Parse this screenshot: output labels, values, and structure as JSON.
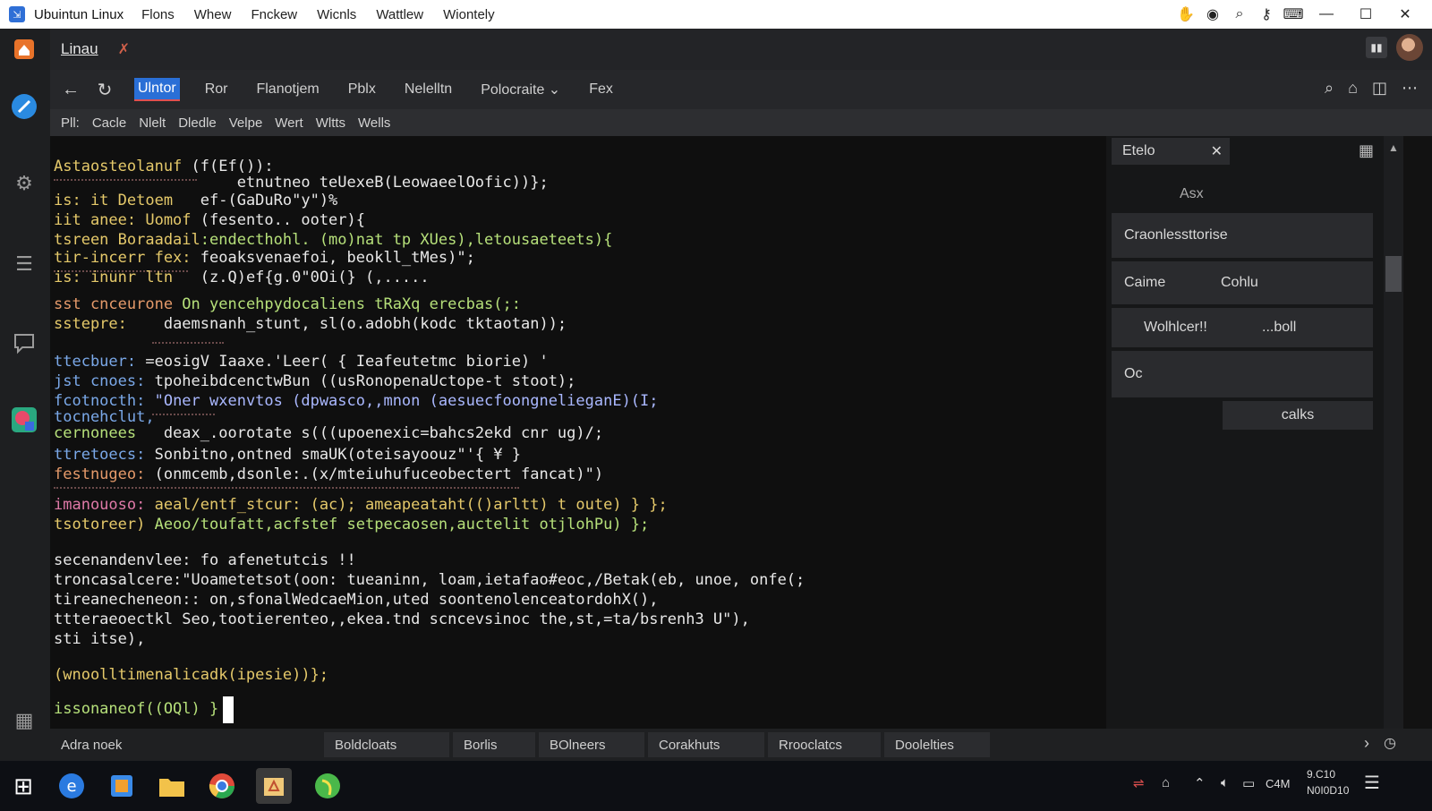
{
  "window": {
    "title": "Ubuintun Linux",
    "menu": [
      "Flons",
      "Whew",
      "Fnckew",
      "Wicnls",
      "Wattlew",
      "Wiontely"
    ],
    "controls": {
      "minimize": "—",
      "maximize": "☐",
      "close": "✕"
    }
  },
  "header": {
    "title": "Linau",
    "pin_glyph": "✗",
    "btn_glyph": "▮▮"
  },
  "nav": {
    "back": "←",
    "refresh": "↻",
    "tabs": [
      "Ulntor",
      "Ror",
      "Flanotjem",
      "Pblx",
      "Nelelltn",
      "Polocraite ⌄",
      "Fex"
    ],
    "active_tab": 0
  },
  "submenu": [
    "Pll:",
    "Cacle",
    "Nlelt",
    "Dledle",
    "Velpe",
    "Wert",
    "Wltts",
    "Wells"
  ],
  "code_lines": [
    {
      "label": "Astaosteolanuf",
      "code": " (f(Ef()):",
      "label_color": "#e5c96a",
      "code_color": "#e8e8e8"
    },
    {
      "label": "",
      "code": "                    etnutneo teUexeB(LeowaeelOofic))};",
      "label_color": "#e5c96a",
      "code_color": "#e8e8e8"
    },
    {
      "label": "is: it Detoem ",
      "code": "  ef-(GaDuRo\"y\")%",
      "label_color": "#e5c96a",
      "code_color": "#e8e8e8"
    },
    {
      "label": "iit anee: Uomof",
      "code": " (fesento.. ooter){",
      "label_color": "#e5c96a",
      "code_color": "#e8e8e8"
    },
    {
      "label": "tsreen Boraadail",
      "code": ":endecthohl. (mo)nat tp XUes),letousaeteets){",
      "label_color": "#e5c96a",
      "code_color": "#b6e07a"
    },
    {
      "label": "tir-incerr fex:",
      "code": " feoaksvenaefoi, beokll_tMes)\";",
      "label_color": "#e5c96a",
      "code_color": "#e8e8e8"
    },
    {
      "label": "is: inunr ltn ",
      "code": "  (z.Q)ef{g.0\"0Oi(} (,.....",
      "label_color": "#e5c96a",
      "code_color": "#e8e8e8"
    },
    {
      "label": "sst cnceurone ",
      "code": "On yencehpydocaliens tRaXq erecbas(;:",
      "label_color": "#e59a6a",
      "code_color": "#b6e07a"
    },
    {
      "label": "sstepre:    ",
      "code": "daemsnanh_stunt, sl(o.adobh(kodc tktaotan));",
      "label_color": "#e5c96a",
      "code_color": "#e8e8e8"
    },
    {
      "label": "ttecbuer:",
      "code": " =eosigV Iaaxe.'Leer( { Ieafeutetmc biorie) '",
      "label_color": "#7aa8e8",
      "code_color": "#e8e8e8"
    },
    {
      "label": "jst cnoes:",
      "code": " tpoheibdcenctwBun ((usRonopenaUctope-t stoot);",
      "label_color": "#7aa8e8",
      "code_color": "#e8e8e8"
    },
    {
      "label": "fcotnocth:",
      "code": " \"Oner wxenvtos (dpwasco,,mnon (aesuecfoongnelieganE)(I;",
      "label_color": "#7aa8e8",
      "code_color": "#aab8ff"
    },
    {
      "label": "tocnehclut,",
      "code": "",
      "label_color": "#7aa8e8",
      "code_color": "#e8e8e8"
    },
    {
      "label": "cernonees   ",
      "code": "deax_.oorotate s(((upoenexic=bahcs2ekd cnr ug)/;",
      "label_color": "#b6e07a",
      "code_color": "#e8e8e8"
    },
    {
      "label": "ttretoecs:",
      "code": " Sonbitno,ontned smaUK(oteisayoouz\"'{ ¥ }",
      "label_color": "#7aa8e8",
      "code_color": "#e8e8e8"
    },
    {
      "label": "festnugeo:",
      "code": " (onmcemb,dsonle:.(x/mteiuhufuceobectert fancat)\")",
      "label_color": "#e59a6a",
      "code_color": "#e8e8e8"
    },
    {
      "label": "imanouoso:",
      "code": " aeal/entf_stcur: (ac); ameapeataht(()arltt) t oute) } };",
      "label_color": "#e07aa8",
      "code_color": "#e5c96a"
    },
    {
      "label": "tsotoreer)",
      "code": " Aeoo/toufatt,acfstef setpecaosen,auctelit otjlohPu) };",
      "label_color": "#e5c96a",
      "code_color": "#b6e07a"
    },
    {
      "label": "secenandenvlee:",
      "code": " fo afenetutcis !!",
      "label_color": "#e8e8e8",
      "code_color": "#e8e8e8"
    },
    {
      "label": "troncasalcere:",
      "code": "\"Uoametetsot(oon: tueaninn, loam,ietafao#eoc,/Betak(eb, unoe, onfe(;",
      "label_color": "#e8e8e8",
      "code_color": "#e8e8e8"
    },
    {
      "label": "tireanecheneon::",
      "code": " on,sfonalWedcaeMion,uted soontenolenceatordohX(),",
      "label_color": "#e8e8e8",
      "code_color": "#e8e8e8"
    },
    {
      "label": "ttteraeoectkl",
      "code": " Seo,tootierenteo,,ekea.tnd scncevsinoc the,st,=ta/bsrenh3 U\"),",
      "label_color": "#e8e8e8",
      "code_color": "#e8e8e8"
    },
    {
      "label": "sti itse),",
      "code": "",
      "label_color": "#e8e8e8",
      "code_color": "#e8e8e8"
    },
    {
      "label": "(wnoolltimenalicadk(ipesie))};",
      "code": "",
      "label_color": "#e5c96a",
      "code_color": "#e8e8e8"
    },
    {
      "label": "issonaneof((OQl) }",
      "code": "",
      "label_color": "#b6e07a",
      "code_color": "#e8e8e8"
    }
  ],
  "right_panel": {
    "title": "Etelo",
    "close_glyph": "✕",
    "grid_glyph": "▦",
    "subtitle": "Asx",
    "item1": "Craonlessttorise",
    "item2_left": "Caime",
    "item2_right": "Cohlu",
    "item3_left": "Wolhlcer!!",
    "item3_right": "...boll",
    "item4": "Oc",
    "button": "calks"
  },
  "bottom_tabs": [
    "Adra noek",
    "Boldcloats",
    "Borlis",
    "BOlneers",
    "Corakhuts",
    "Rrooclatcs",
    "Doolelties"
  ],
  "bottom_right": {
    "chevron": "›",
    "clock_glyph": "◷"
  },
  "taskbar": {
    "time": "9.C10",
    "date": "N0I0D10",
    "tray_label": "C4M",
    "start_glyph": "⊞",
    "notify_glyph": "☰"
  },
  "colors": {
    "accent": "#2a6fd6",
    "editor_bg": "#0f0f0f",
    "tab_underline": "#e05050"
  }
}
